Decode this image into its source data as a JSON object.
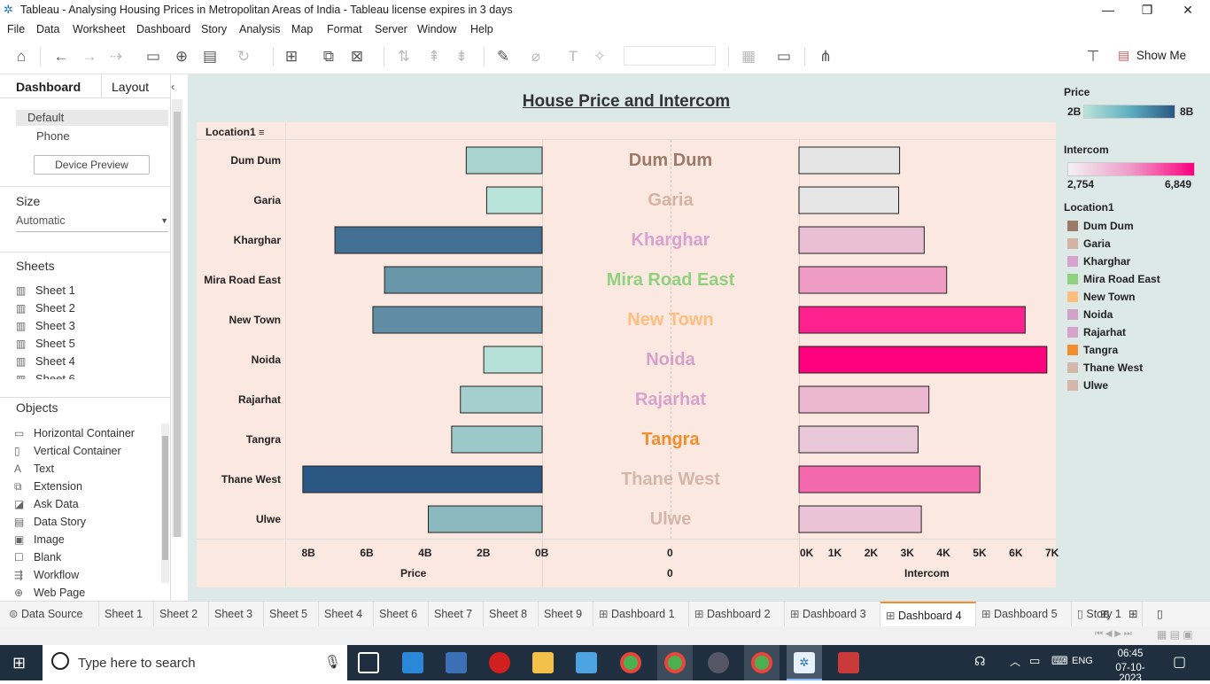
{
  "window": {
    "title": "Tableau - Analysing Housing Prices in Metropolitan Areas of India - Tableau license expires in 3 days",
    "minimize": "—",
    "restore": "❐",
    "close": "✕"
  },
  "menu": [
    "File",
    "Data",
    "Worksheet",
    "Dashboard",
    "Story",
    "Analysis",
    "Map",
    "Format",
    "Server",
    "Window",
    "Help"
  ],
  "toolbar": {
    "show_me": "Show Me"
  },
  "left_pane": {
    "tabs": [
      "Dashboard",
      "Layout"
    ],
    "device_options": [
      "Default",
      "Phone"
    ],
    "device_preview_button": "Device Preview",
    "size_label": "Size",
    "size_value": "Automatic",
    "sheets_label": "Sheets",
    "sheets": [
      "Sheet 1",
      "Sheet 2",
      "Sheet 3",
      "Sheet 5",
      "Sheet 4",
      "Sheet 6"
    ],
    "objects_label": "Objects",
    "objects": [
      {
        "label": "Horizontal Container",
        "icon": "horizontal-container-icon",
        "glyph": "▭"
      },
      {
        "label": "Vertical Container",
        "icon": "vertical-container-icon",
        "glyph": "▯"
      },
      {
        "label": "Text",
        "icon": "text-icon",
        "glyph": "A"
      },
      {
        "label": "Extension",
        "icon": "extension-icon",
        "glyph": "⧉"
      },
      {
        "label": "Ask Data",
        "icon": "ask-data-icon",
        "glyph": "◪"
      },
      {
        "label": "Data Story",
        "icon": "data-story-icon",
        "glyph": "▤"
      },
      {
        "label": "Image",
        "icon": "image-icon",
        "glyph": "▣"
      },
      {
        "label": "Blank",
        "icon": "blank-icon",
        "glyph": "☐"
      },
      {
        "label": "Workflow",
        "icon": "workflow-icon",
        "glyph": "⇶"
      },
      {
        "label": "Web Page",
        "icon": "web-page-icon",
        "glyph": "⊕"
      }
    ]
  },
  "dashboard": {
    "title": "House Price and Intercom",
    "row_header": "Location1",
    "axis_price_title": "Price",
    "axis_mid_title": "0",
    "axis_mid_tick": "0",
    "axis_intercom_title": "Intercom",
    "price_ticks": [
      "8B",
      "6B",
      "4B",
      "2B",
      "0B"
    ],
    "intercom_ticks": [
      "0K",
      "1K",
      "2K",
      "3K",
      "4K",
      "5K",
      "6K",
      "7K"
    ]
  },
  "chart_data": {
    "type": "bar",
    "title": "House Price and Intercom",
    "categories": [
      "Dum Dum",
      "Garia",
      "Kharghar",
      "Mira Road East",
      "New Town",
      "Noida",
      "Rajarhat",
      "Tangra",
      "Thane West",
      "Ulwe"
    ],
    "series": [
      {
        "name": "Price",
        "values": [
          2600000000.0,
          1900000000.0,
          7100000000.0,
          5400000000.0,
          5800000000.0,
          2000000000.0,
          2800000000.0,
          3100000000.0,
          8200000000.0,
          3900000000.0
        ],
        "xlim": [
          0,
          8500000000.0
        ],
        "direction": "right-to-left"
      },
      {
        "name": "Intercom",
        "values": [
          2780,
          2754,
          3460,
          4080,
          6250,
          6849,
          3590,
          3290,
          5000,
          3380
        ],
        "xlim": [
          0,
          7000
        ],
        "direction": "left-to-right"
      }
    ],
    "label_colors": [
      "#9b7a6a",
      "#d4b3a5",
      "#d7a2cf",
      "#8fd17f",
      "#ffbe7d",
      "#d3a2cb",
      "#d6a3cd",
      "#f28e2b",
      "#d4b6aa",
      "#d4b6aa"
    ],
    "price_color_range": [
      "#b8e3d9",
      "#2a5783"
    ],
    "intercom_color_range": [
      "#e6e6e6",
      "#ff007f"
    ],
    "price_axis_label": "Price",
    "intercom_axis_label": "Intercom"
  },
  "legends": {
    "price_title": "Price",
    "price_min": "2B",
    "price_max": "8B",
    "intercom_title": "Intercom",
    "intercom_min": "2,754",
    "intercom_max": "6,849",
    "location_title": "Location1",
    "locations": [
      {
        "name": "Dum Dum",
        "color": "#9b7a6a"
      },
      {
        "name": "Garia",
        "color": "#d4b3a5"
      },
      {
        "name": "Kharghar",
        "color": "#d7a2cf"
      },
      {
        "name": "Mira Road East",
        "color": "#8fd17f"
      },
      {
        "name": "New Town",
        "color": "#ffbe7d"
      },
      {
        "name": "Noida",
        "color": "#d3a2cb"
      },
      {
        "name": "Rajarhat",
        "color": "#d6a3cd"
      },
      {
        "name": "Tangra",
        "color": "#f28e2b"
      },
      {
        "name": "Thane West",
        "color": "#d4b6aa"
      },
      {
        "name": "Ulwe",
        "color": "#d4b6aa"
      }
    ]
  },
  "bottom_tabs": [
    {
      "label": "Data Source",
      "glyph": "⊜",
      "active": false
    },
    {
      "label": "Sheet 1",
      "glyph": "",
      "active": false
    },
    {
      "label": "Sheet 2",
      "glyph": "",
      "active": false
    },
    {
      "label": "Sheet 3",
      "glyph": "",
      "active": false
    },
    {
      "label": "Sheet 5",
      "glyph": "",
      "active": false
    },
    {
      "label": "Sheet 4",
      "glyph": "",
      "active": false
    },
    {
      "label": "Sheet 6",
      "glyph": "",
      "active": false
    },
    {
      "label": "Sheet 7",
      "glyph": "",
      "active": false
    },
    {
      "label": "Sheet 8",
      "glyph": "",
      "active": false
    },
    {
      "label": "Sheet 9",
      "glyph": "",
      "active": false
    },
    {
      "label": "Dashboard 1",
      "glyph": "⊞",
      "active": false
    },
    {
      "label": "Dashboard 2",
      "glyph": "⊞",
      "active": false
    },
    {
      "label": "Dashboard 3",
      "glyph": "⊞",
      "active": false
    },
    {
      "label": "Dashboard 4",
      "glyph": "⊞",
      "active": true
    },
    {
      "label": "Dashboard 5",
      "glyph": "⊞",
      "active": false
    },
    {
      "label": "Story 1",
      "glyph": "▯",
      "active": false
    }
  ],
  "taskbar": {
    "search_placeholder": "Type here to search",
    "language": "ENG",
    "time": "06:45",
    "date": "07-10-2023"
  }
}
